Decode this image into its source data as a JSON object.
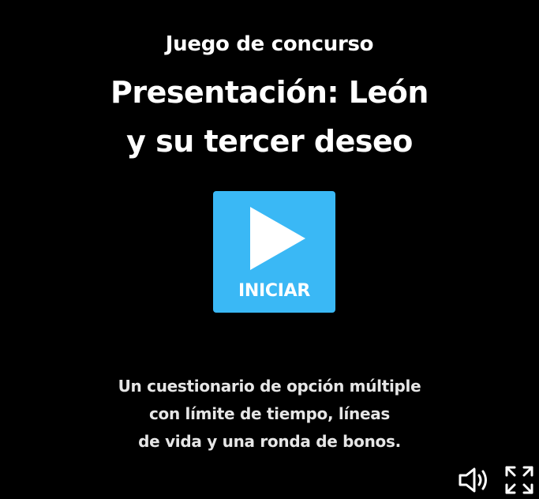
{
  "intro": {
    "subtitle": "Juego de concurso",
    "title_lines": [
      "Presentación: León",
      "y su tercer deseo"
    ],
    "start_label": "INICIAR",
    "description_lines": [
      "Un cuestionario de opción múltiple",
      "con límite de tiempo, líneas",
      "de vida y una ronda de bonos."
    ]
  },
  "controls": {
    "volume_icon": "speaker-volume-icon",
    "fullscreen_icon": "fullscreen-expand-icon"
  },
  "colors": {
    "background": "#000000",
    "accent": "#3ab8f5",
    "text": "#ffffff",
    "description_text": "#e6e6e6"
  }
}
